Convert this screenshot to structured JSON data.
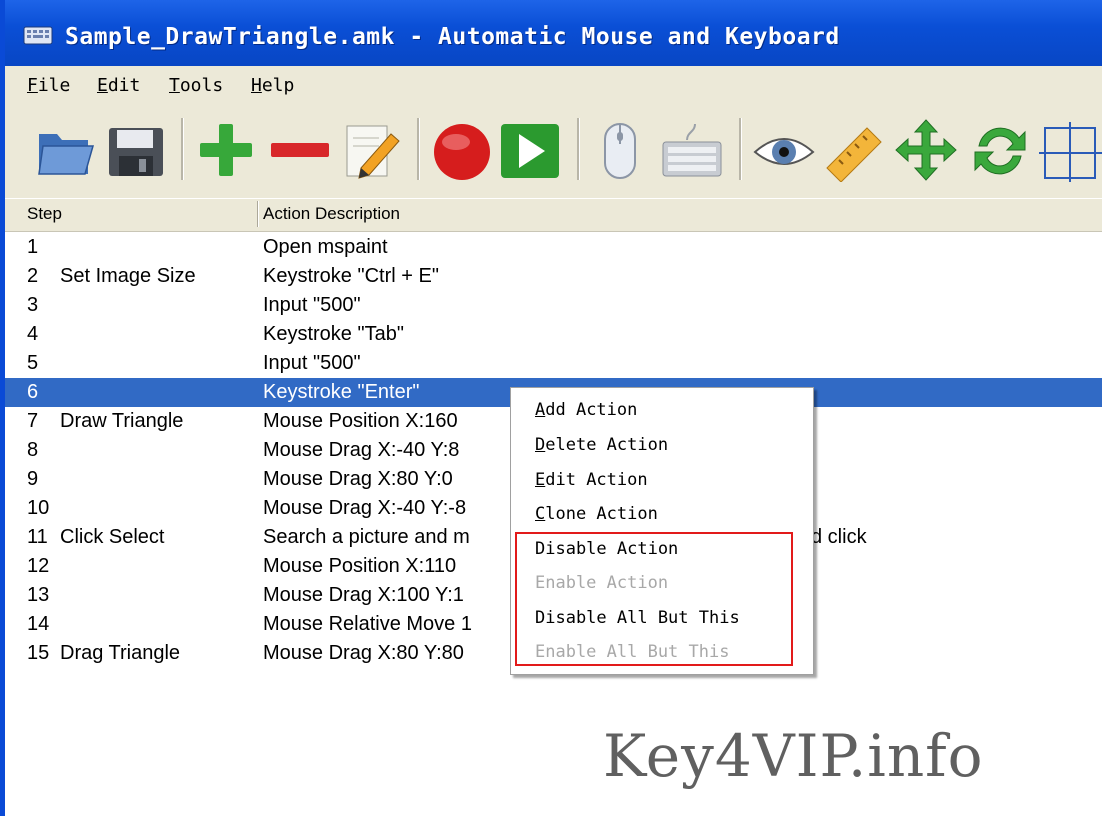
{
  "window": {
    "title": "Sample_DrawTriangle.amk - Automatic Mouse and Keyboard"
  },
  "menu": [
    {
      "key": "F",
      "rest": "ile"
    },
    {
      "key": "E",
      "rest": "dit"
    },
    {
      "key": "T",
      "rest": "ools"
    },
    {
      "key": "H",
      "rest": "elp"
    }
  ],
  "toolbar": {
    "icons": [
      "open-folder-icon",
      "save-floppy-icon",
      "add-plus-icon",
      "remove-minus-icon",
      "edit-pencil-icon",
      "record-icon",
      "play-icon",
      "mouse-icon",
      "keyboard-icon",
      "eye-icon",
      "ruler-icon",
      "move-arrows-icon",
      "refresh-icon",
      "select-region-icon"
    ]
  },
  "list": {
    "columns": [
      "Step",
      "Action Description"
    ],
    "selected_row": 6,
    "rows": [
      {
        "num": "1",
        "name": "",
        "action": "Open mspaint"
      },
      {
        "num": "2",
        "name": "Set Image Size",
        "action": "Keystroke \"Ctrl + E\""
      },
      {
        "num": "3",
        "name": "",
        "action": "Input \"500\""
      },
      {
        "num": "4",
        "name": "",
        "action": "Keystroke \"Tab\""
      },
      {
        "num": "5",
        "name": "",
        "action": "Input \"500\""
      },
      {
        "num": "6",
        "name": "",
        "action": "Keystroke \"Enter\""
      },
      {
        "num": "7",
        "name": "Draw Triangle",
        "action": "Mouse Position X:160"
      },
      {
        "num": "8",
        "name": "",
        "action": "Mouse Drag X:-40 Y:8"
      },
      {
        "num": "9",
        "name": "",
        "action": "Mouse Drag X:80 Y:0"
      },
      {
        "num": "10",
        "name": "",
        "action": "Mouse Drag X:-40 Y:-8"
      },
      {
        "num": "11",
        "name": "Click Select",
        "action": "Search a picture and m",
        "action_tail": "d click"
      },
      {
        "num": "12",
        "name": "",
        "action": "Mouse Position X:110"
      },
      {
        "num": "13",
        "name": "",
        "action": "Mouse Drag X:100 Y:1"
      },
      {
        "num": "14",
        "name": "",
        "action": "Mouse Relative Move 1"
      },
      {
        "num": "15",
        "name": "Drag Triangle",
        "action": "Mouse Drag X:80 Y:80"
      }
    ]
  },
  "context_menu": {
    "items": [
      {
        "key": "A",
        "rest": "dd Action",
        "enabled": true
      },
      {
        "key": "D",
        "rest": "elete Action",
        "enabled": true
      },
      {
        "key": "E",
        "rest": "dit Action",
        "enabled": true
      },
      {
        "key": "C",
        "rest": "lone Action",
        "enabled": true
      },
      {
        "key": "",
        "rest": "Disable Action",
        "enabled": true
      },
      {
        "key": "",
        "rest": "Enable Action",
        "enabled": false
      },
      {
        "key": "",
        "rest": "Disable All But This",
        "enabled": true
      },
      {
        "key": "",
        "rest": "Enable All But This",
        "enabled": false
      }
    ],
    "highlight_color": "#e21a1a"
  },
  "watermark": "Key4VIP.info",
  "colors": {
    "titlebar": "#0a4fd6",
    "selection": "#316ac5",
    "chrome": "#ece9d8"
  }
}
